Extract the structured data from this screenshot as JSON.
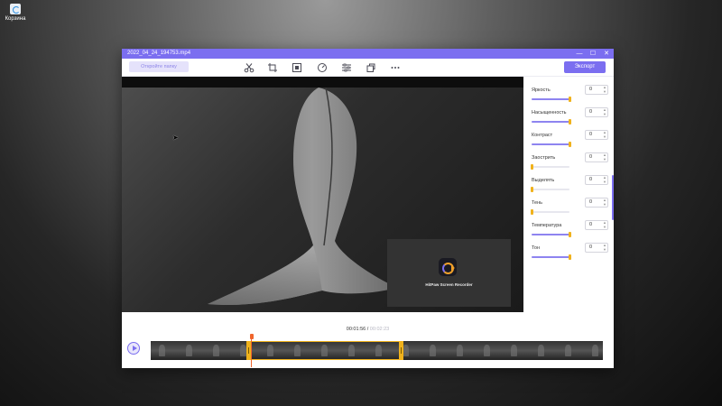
{
  "desktop": {
    "icon_label": "Корзина"
  },
  "window": {
    "title": "2022_04_24_194753.mp4",
    "controls": [
      "—",
      "☐",
      "✕"
    ]
  },
  "toolbar": {
    "open_folder_label": "Откройте папку",
    "export_label": "Экспорт",
    "tools": [
      "scissors-icon",
      "crop-icon",
      "adjust-icon",
      "speed-icon",
      "sliders-icon",
      "copy-icon",
      "more-icon"
    ]
  },
  "overlay": {
    "app_name": "HitPaw Screen Recorder"
  },
  "adjustments": [
    {
      "label": "Яркость",
      "value": "0",
      "level": 1.0
    },
    {
      "label": "Насыщенность",
      "value": "0",
      "level": 1.0
    },
    {
      "label": "Контраст",
      "value": "0",
      "level": 1.0
    },
    {
      "label": "Заострить",
      "value": "0",
      "level": 0.0
    },
    {
      "label": "Выделять",
      "value": "0",
      "level": 0.0
    },
    {
      "label": "Тень",
      "value": "0",
      "level": 0.0
    },
    {
      "label": "Температура",
      "value": "0",
      "level": 1.0
    },
    {
      "label": "Тон",
      "value": "0",
      "level": 1.0
    }
  ],
  "timeline": {
    "current_time": "00:01:56",
    "separator": "/",
    "total_time": "00:02:23",
    "thumbnail_count": 17
  },
  "colors": {
    "accent": "#7b6ef0",
    "handle": "#f0b21c",
    "playhead": "#f0652c"
  }
}
